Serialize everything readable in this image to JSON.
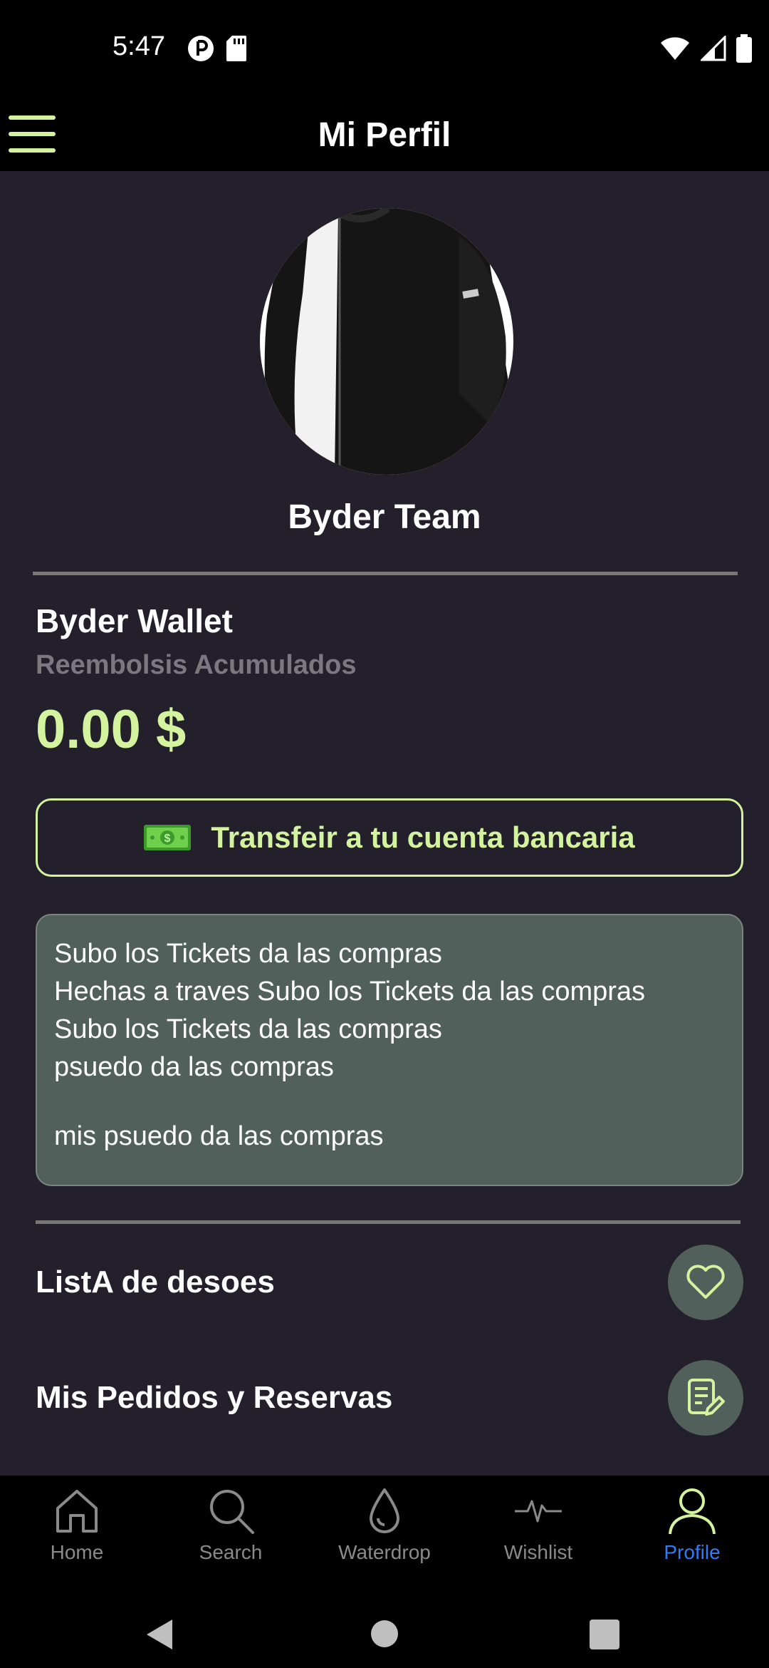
{
  "status_bar": {
    "time": "5:47"
  },
  "header": {
    "title": "Mi Perfil"
  },
  "profile": {
    "name": "Byder Team"
  },
  "wallet": {
    "title": "Byder Wallet",
    "subtitle": "Reembolsis Acumulados",
    "amount": "0.00 $",
    "transfer_label": "Transfeir a tu cuenta bancaria"
  },
  "info": {
    "lines": [
      "Subo los Tickets da las compras",
      "Hechas a traves Subo los Tickets da las compras",
      "Subo los Tickets da las compras",
      "psuedo da las compras",
      "mis psuedo da las compras"
    ]
  },
  "menu": {
    "items": [
      {
        "label": "ListA de desoes",
        "icon": "heart-icon"
      },
      {
        "label": "Mis Pedidos y  Reservas",
        "icon": "order-edit-icon"
      }
    ]
  },
  "nav": {
    "items": [
      {
        "label": "Home",
        "icon": "home-icon"
      },
      {
        "label": "Search",
        "icon": "search-icon"
      },
      {
        "label": "Waterdrop",
        "icon": "waterdrop-icon"
      },
      {
        "label": "Wishlist",
        "icon": "pulse-icon"
      },
      {
        "label": "Profile",
        "icon": "person-icon",
        "active": true
      }
    ]
  },
  "colors": {
    "accent": "#d4f39e",
    "background": "#231f2b",
    "card": "#52605c",
    "active_nav": "#2f7cf6"
  }
}
